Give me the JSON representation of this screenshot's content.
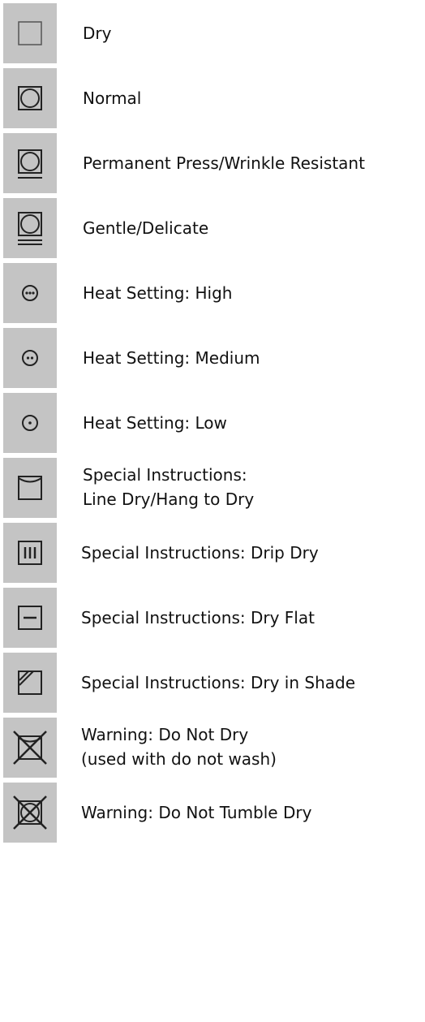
{
  "items": [
    {
      "label": "Dry",
      "icon": "dry-square-icon"
    },
    {
      "label": "Normal",
      "icon": "tumble-dry-normal-icon"
    },
    {
      "label": "Permanent Press/Wrinkle Resistant",
      "icon": "tumble-dry-permanent-press-icon"
    },
    {
      "label": "Gentle/Delicate",
      "icon": "tumble-dry-gentle-icon"
    },
    {
      "label": "Heat Setting: High",
      "icon": "heat-high-icon"
    },
    {
      "label": "Heat Setting: Medium",
      "icon": "heat-medium-icon"
    },
    {
      "label": "Heat Setting: Low",
      "icon": "heat-low-icon"
    },
    {
      "label_line1": "Special Instructions:",
      "label_line2": "Line Dry/Hang to Dry",
      "icon": "line-dry-icon"
    },
    {
      "label": "Special Instructions: Drip Dry",
      "icon": "drip-dry-icon"
    },
    {
      "label": "Special Instructions: Dry Flat",
      "icon": "dry-flat-icon"
    },
    {
      "label": "Special Instructions: Dry in Shade",
      "icon": "dry-in-shade-icon"
    },
    {
      "label_line1": "Warning: Do Not Dry",
      "label_line2": "(used with do not wash)",
      "icon": "do-not-dry-icon"
    },
    {
      "label": "Warning: Do Not Tumble Dry",
      "icon": "do-not-tumble-dry-icon"
    }
  ],
  "colors": {
    "icon_background": "#c4c4c4",
    "symbol": "#222222",
    "text": "#111111"
  }
}
